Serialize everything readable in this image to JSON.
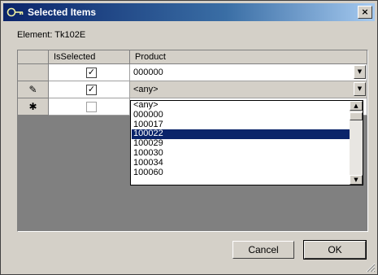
{
  "window": {
    "title": "Selected Items",
    "close_label": "×"
  },
  "element_label": "Element: Tk102E",
  "grid": {
    "columns": [
      "IsSelected",
      "Product"
    ],
    "rows": [
      {
        "row_marker": "",
        "is_selected": "✓",
        "product": "000000"
      },
      {
        "row_marker": "✎",
        "is_selected": "✓",
        "product": "<any>"
      },
      {
        "row_marker": "✱",
        "is_selected": "",
        "product": ""
      }
    ]
  },
  "dropdown": {
    "items": [
      "<any>",
      "000000",
      "100017",
      "100022",
      "100029",
      "100030",
      "100034",
      "100060"
    ],
    "selected": "100022"
  },
  "buttons": {
    "cancel": "Cancel",
    "ok": "OK"
  },
  "colors": {
    "title_bar": "#0a246a",
    "selection": "#0a246a",
    "grid_background": "#808080"
  }
}
